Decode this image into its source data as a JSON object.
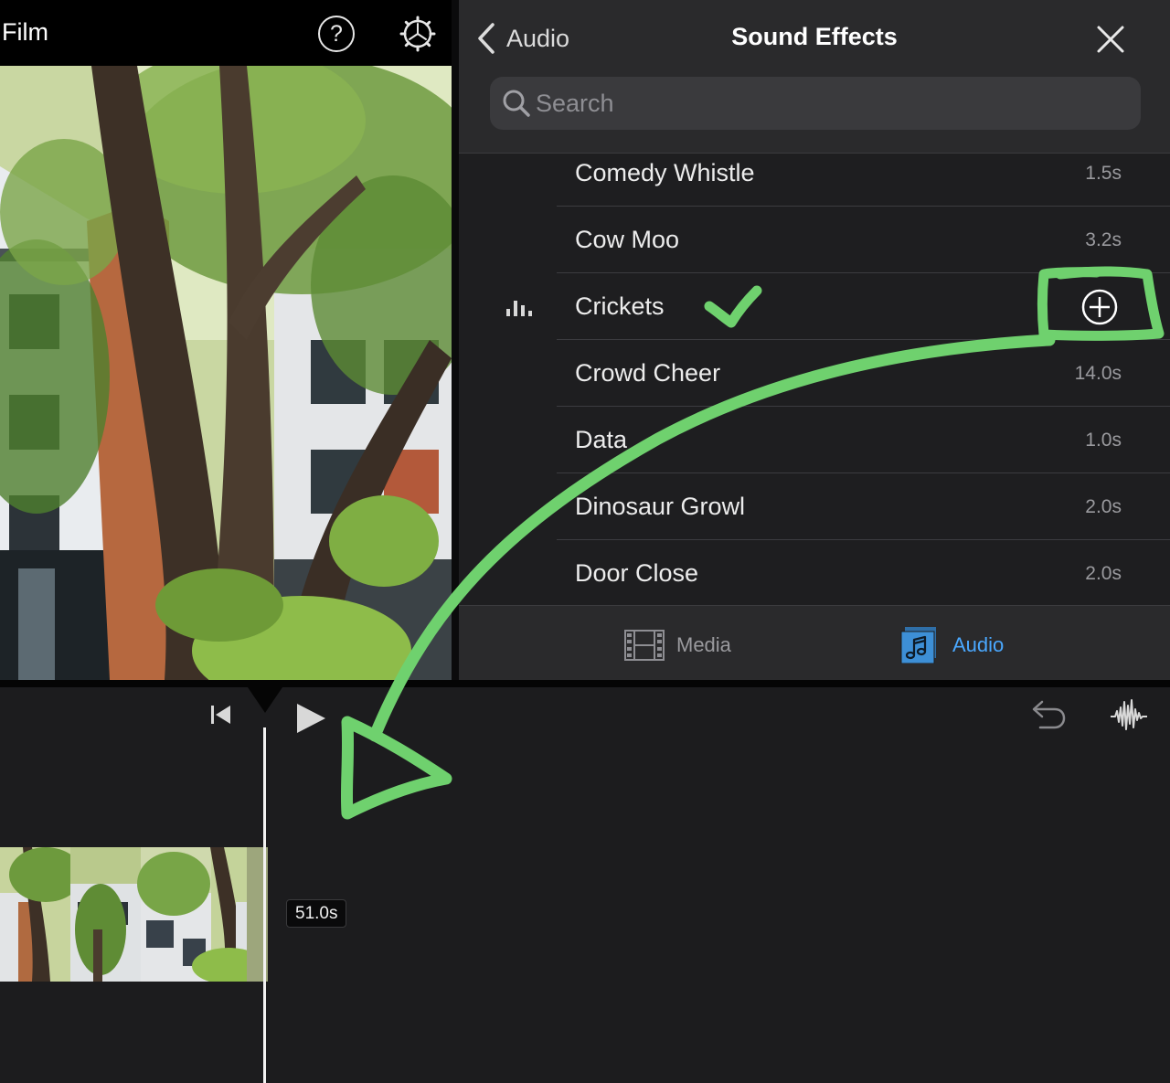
{
  "project": {
    "title": "Film"
  },
  "browser": {
    "back_label": "Audio",
    "title": "Sound Effects",
    "search": {
      "placeholder": "Search",
      "value": ""
    },
    "items": [
      {
        "name": "Comedy Whistle",
        "duration": "1.5s"
      },
      {
        "name": "Cow Moo",
        "duration": "3.2s"
      },
      {
        "name": "Crickets",
        "duration": "",
        "selected": true
      },
      {
        "name": "Crowd Cheer",
        "duration": "14.0s"
      },
      {
        "name": "Data",
        "duration": "1.0s"
      },
      {
        "name": "Dinosaur Growl",
        "duration": "2.0s"
      },
      {
        "name": "Door Close",
        "duration": "2.0s"
      }
    ],
    "tabs": [
      {
        "label": "Media",
        "icon": "film-strip-icon",
        "active": false
      },
      {
        "label": "Audio",
        "icon": "music-note-icon",
        "active": true
      }
    ]
  },
  "timeline": {
    "clip_duration": "51.0s"
  },
  "icons": {
    "help": "question-circle-icon",
    "settings": "gear-icon",
    "close": "close-icon",
    "search": "search-icon",
    "playing": "equalizer-icon",
    "add": "plus-circle-icon",
    "skip_start": "skip-to-start-icon",
    "play": "play-icon",
    "undo": "undo-icon",
    "waveform": "waveform-icon"
  },
  "colors": {
    "annotation_green": "#6fd16e",
    "accent_blue": "#4aa8ff",
    "panel_bg": "#1e1e20",
    "header_bg": "#2a2a2c"
  }
}
